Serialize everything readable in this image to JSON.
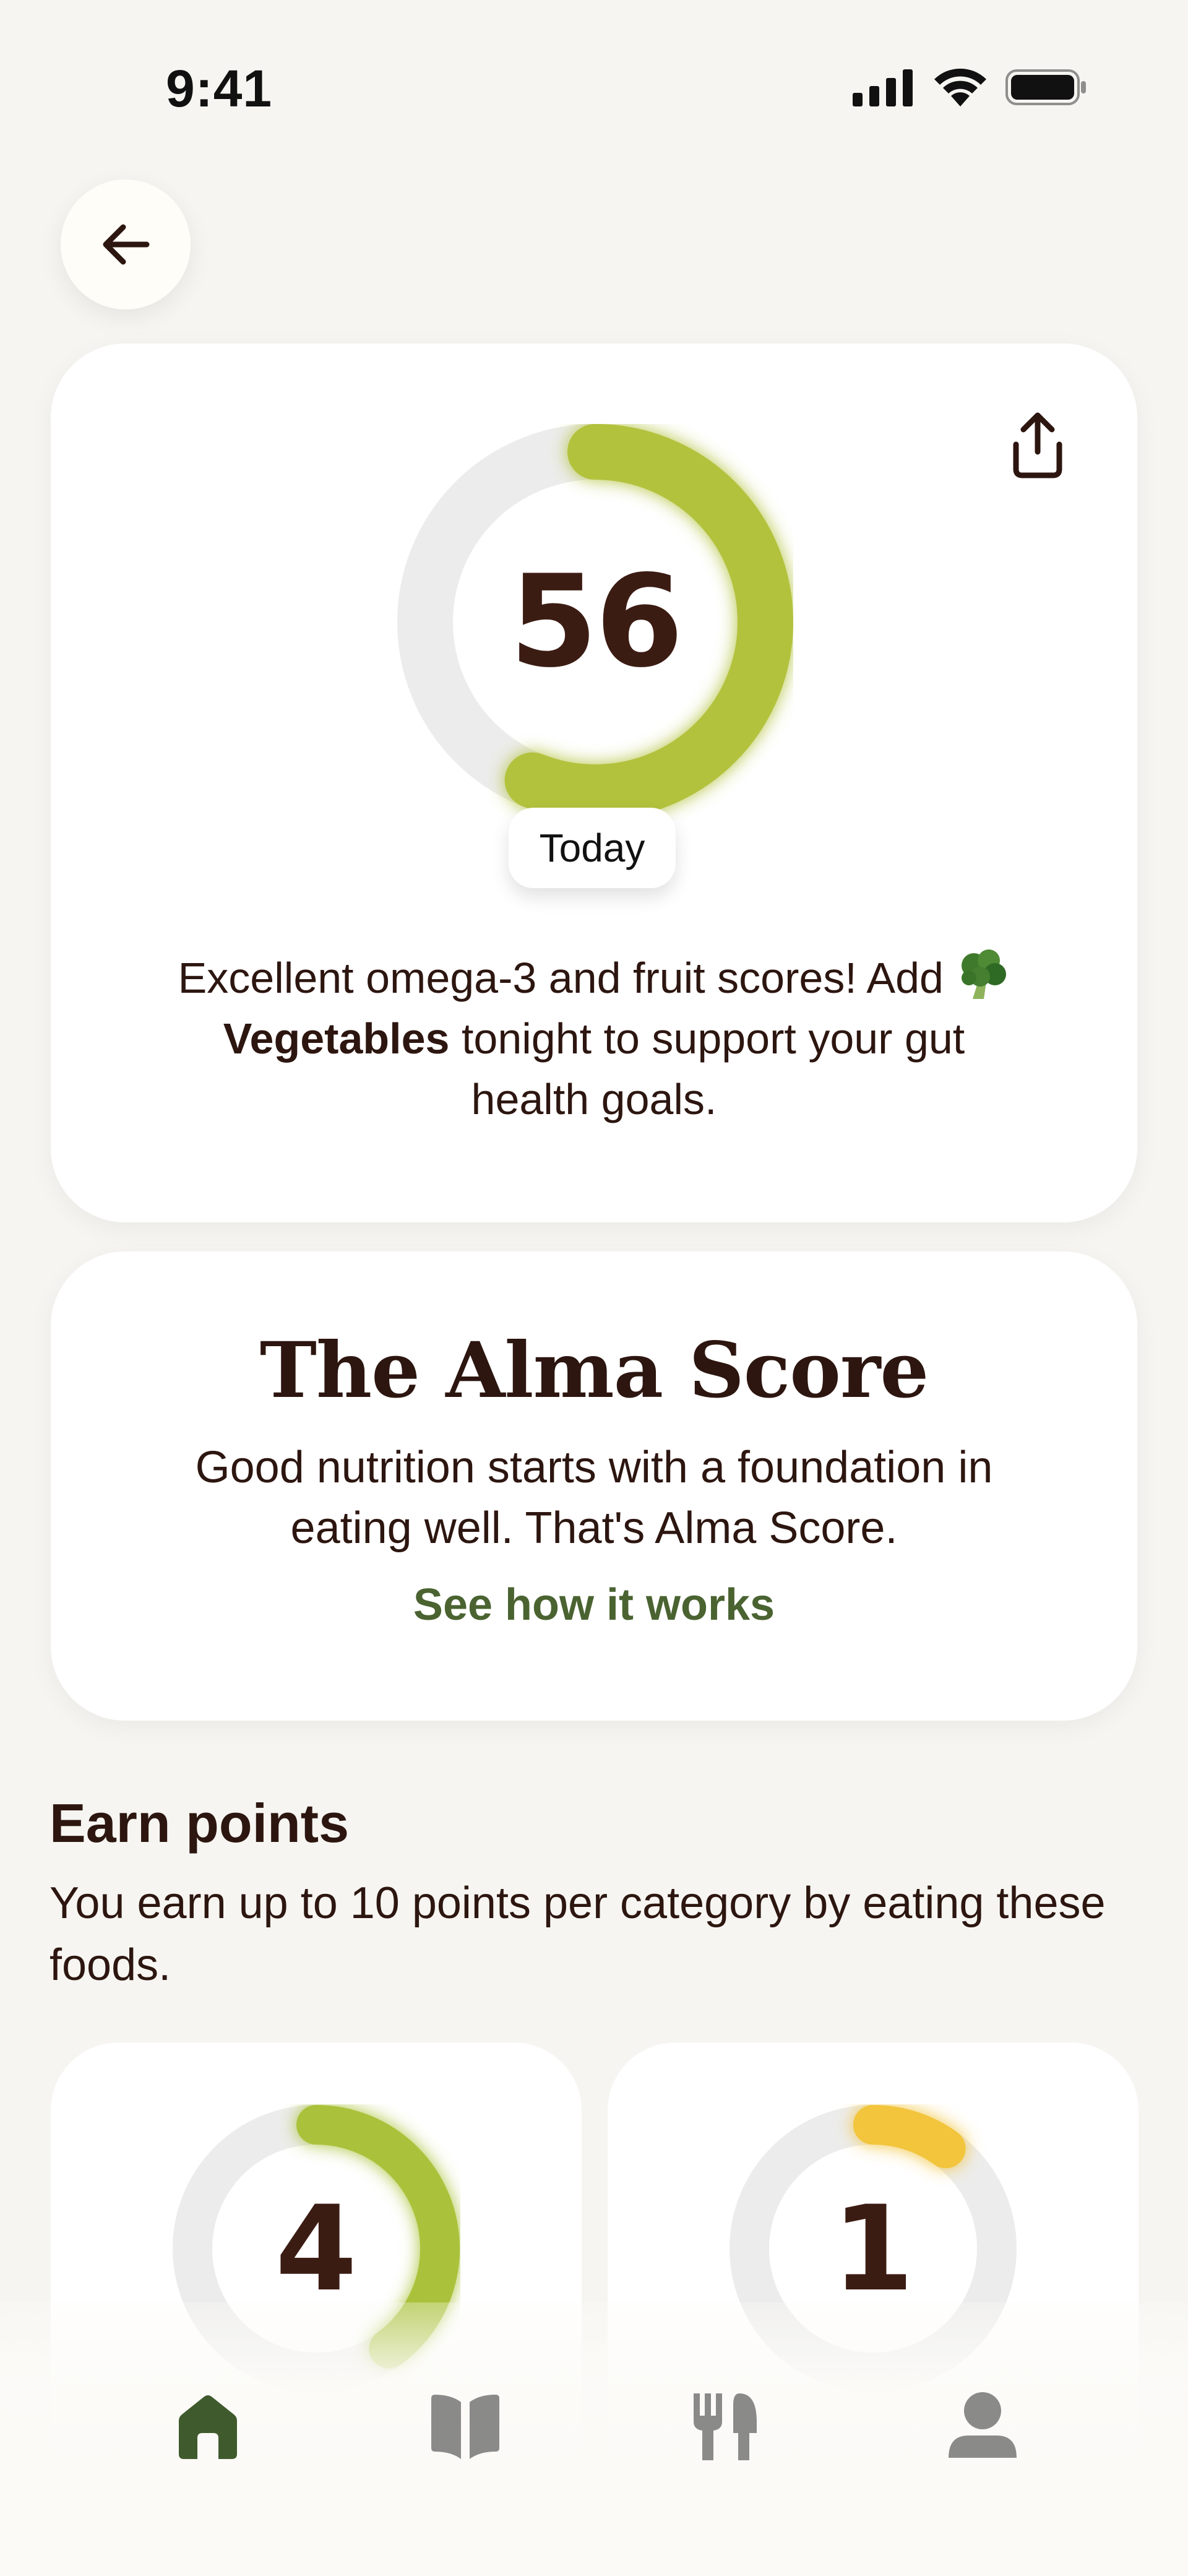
{
  "status_bar": {
    "time": "9:41"
  },
  "score_card": {
    "score": "56",
    "score_value": 56,
    "score_max": 100,
    "period_label": "Today",
    "message_part1": "Excellent omega-3 and fruit scores! Add ",
    "message_highlight": "Vegetables",
    "message_part2": " tonight to support your gut health goals.",
    "colors": {
      "ring_fill": "#b3c23c",
      "ring_track": "#ececec"
    }
  },
  "info_card": {
    "title": "The Alma Score",
    "text": "Good nutrition starts with a foundation in eating well. That's Alma Score.",
    "link": "See how it works",
    "link_color": "#4a6331"
  },
  "earn_points": {
    "title": "Earn points",
    "subtitle": "You earn up to 10 points per category by eating these foods.",
    "categories": [
      {
        "score": "4",
        "value": 4,
        "max": 10,
        "color": "#aac23a"
      },
      {
        "score": "1",
        "value": 1,
        "max": 10,
        "color": "#f2c53d"
      }
    ]
  },
  "nav": {
    "items": [
      {
        "icon": "home-icon",
        "active": true
      },
      {
        "icon": "book-icon",
        "active": false
      },
      {
        "icon": "utensils-icon",
        "active": false
      },
      {
        "icon": "profile-icon",
        "active": false
      }
    ],
    "active_color": "#3f5a2c",
    "inactive_color": "#8a8a88"
  }
}
